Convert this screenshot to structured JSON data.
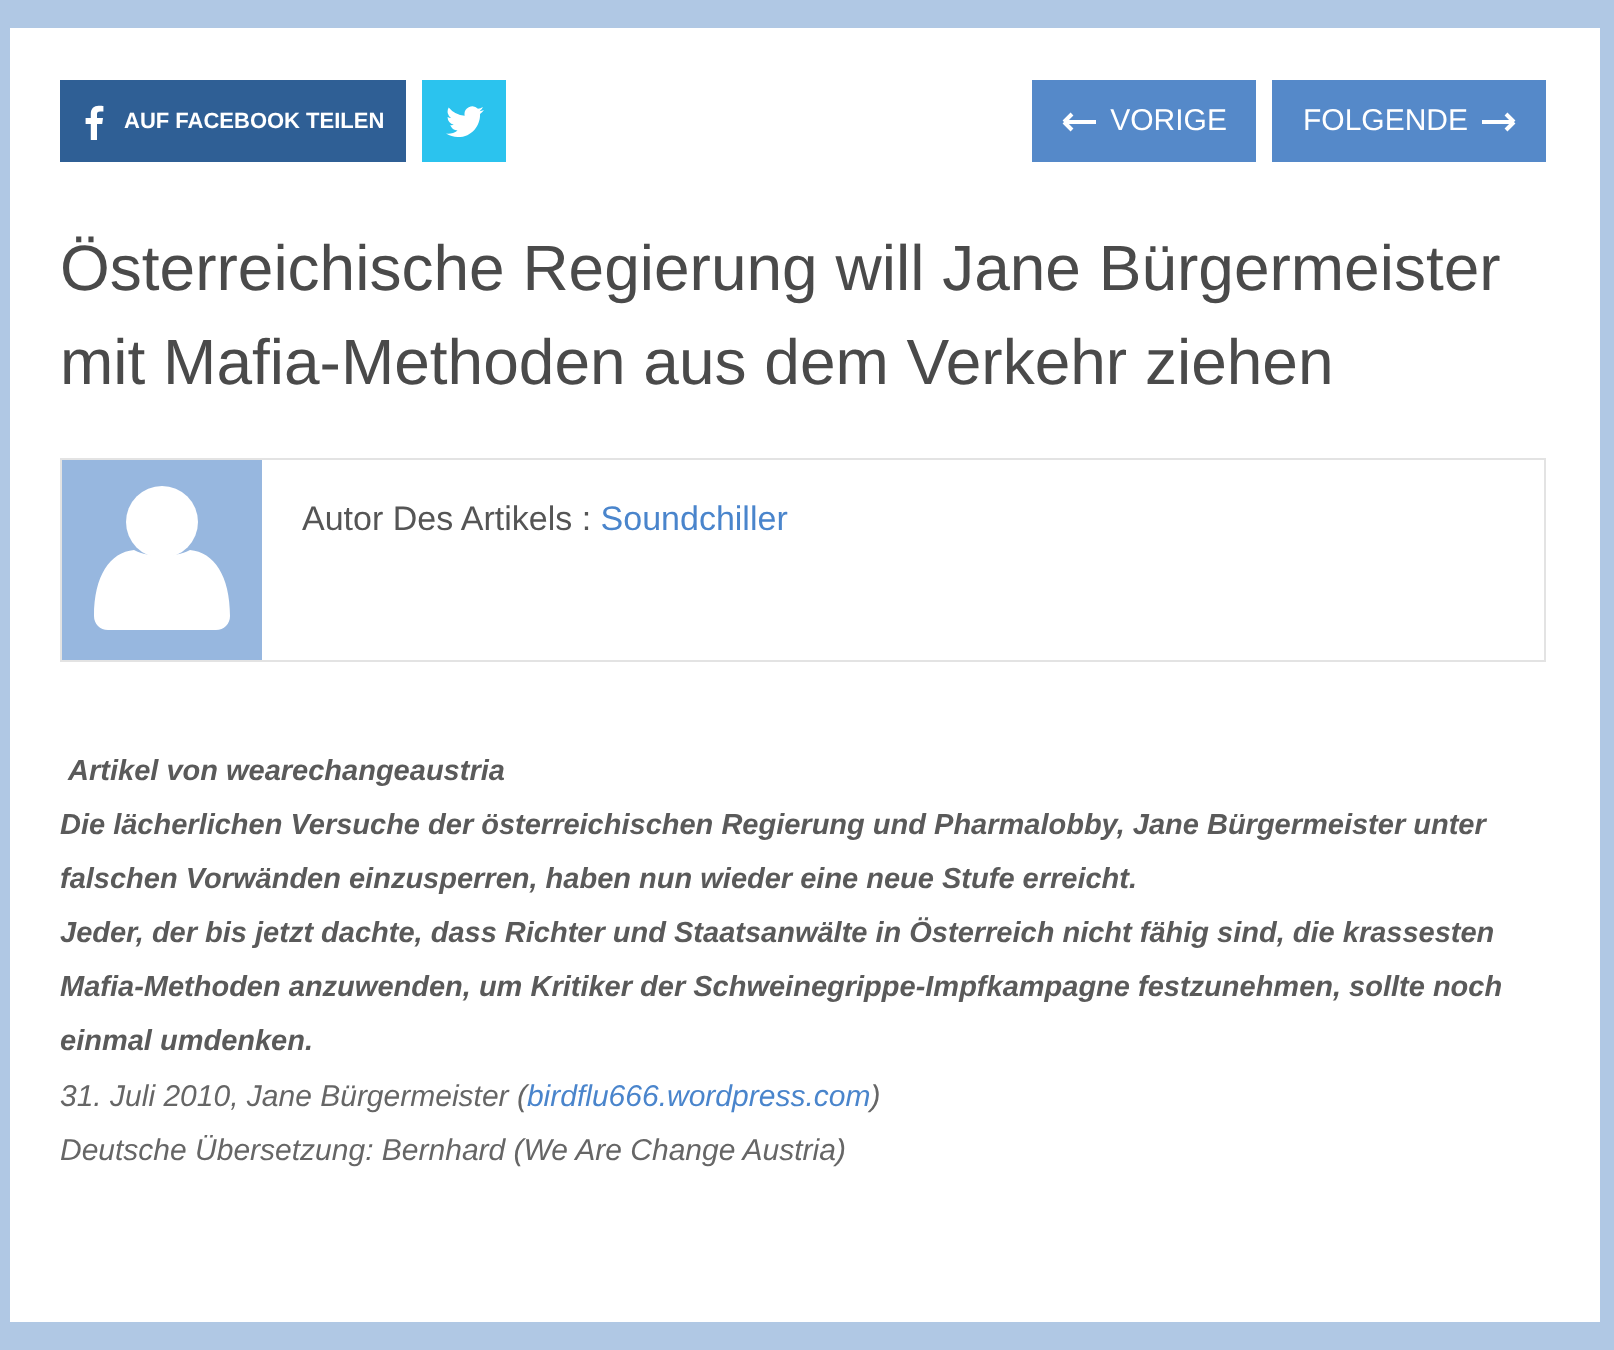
{
  "share_buttons": [
    {
      "kind": "facebook",
      "label": "AUF FACEBOOK TEILEN"
    },
    {
      "kind": "twitter"
    }
  ],
  "nav_buttons": [
    {
      "kind": "previous",
      "label": "VORIGE"
    },
    {
      "kind": "next",
      "label": "FOLGENDE"
    }
  ],
  "title": "Österreichische Regierung will Jane Bürgermeister mit Mafia-Methoden aus dem Verkehr ziehen",
  "author": {
    "label": "Autor Des Artikels :",
    "name": "Soundchiller"
  },
  "article": {
    "lead": [
      " Artikel von wearechangeaustria",
      "Die lächerlichen Versuche der österreichischen Regierung und Pharmalobby, Jane Bürgermeister unter falschen Vorwänden einzusperren, haben nun wieder eine neue Stufe erreicht.",
      "Jeder, der bis jetzt dachte, dass Richter und Staatsanwälte in Österreich nicht fähig sind, die krassesten Mafia-Methoden anzuwenden, um Kritiker der Schweinegrippe-Impfkampagne festzunehmen, sollte noch einmal umdenken."
    ],
    "source": {
      "prefix": "31. Juli 2010, Jane Bürgermeister (",
      "link": "birdflu666.wordpress.com",
      "suffix": ")"
    },
    "translation": "Deutsche Übersetzung: Bernhard (We Are Change Austria)"
  }
}
